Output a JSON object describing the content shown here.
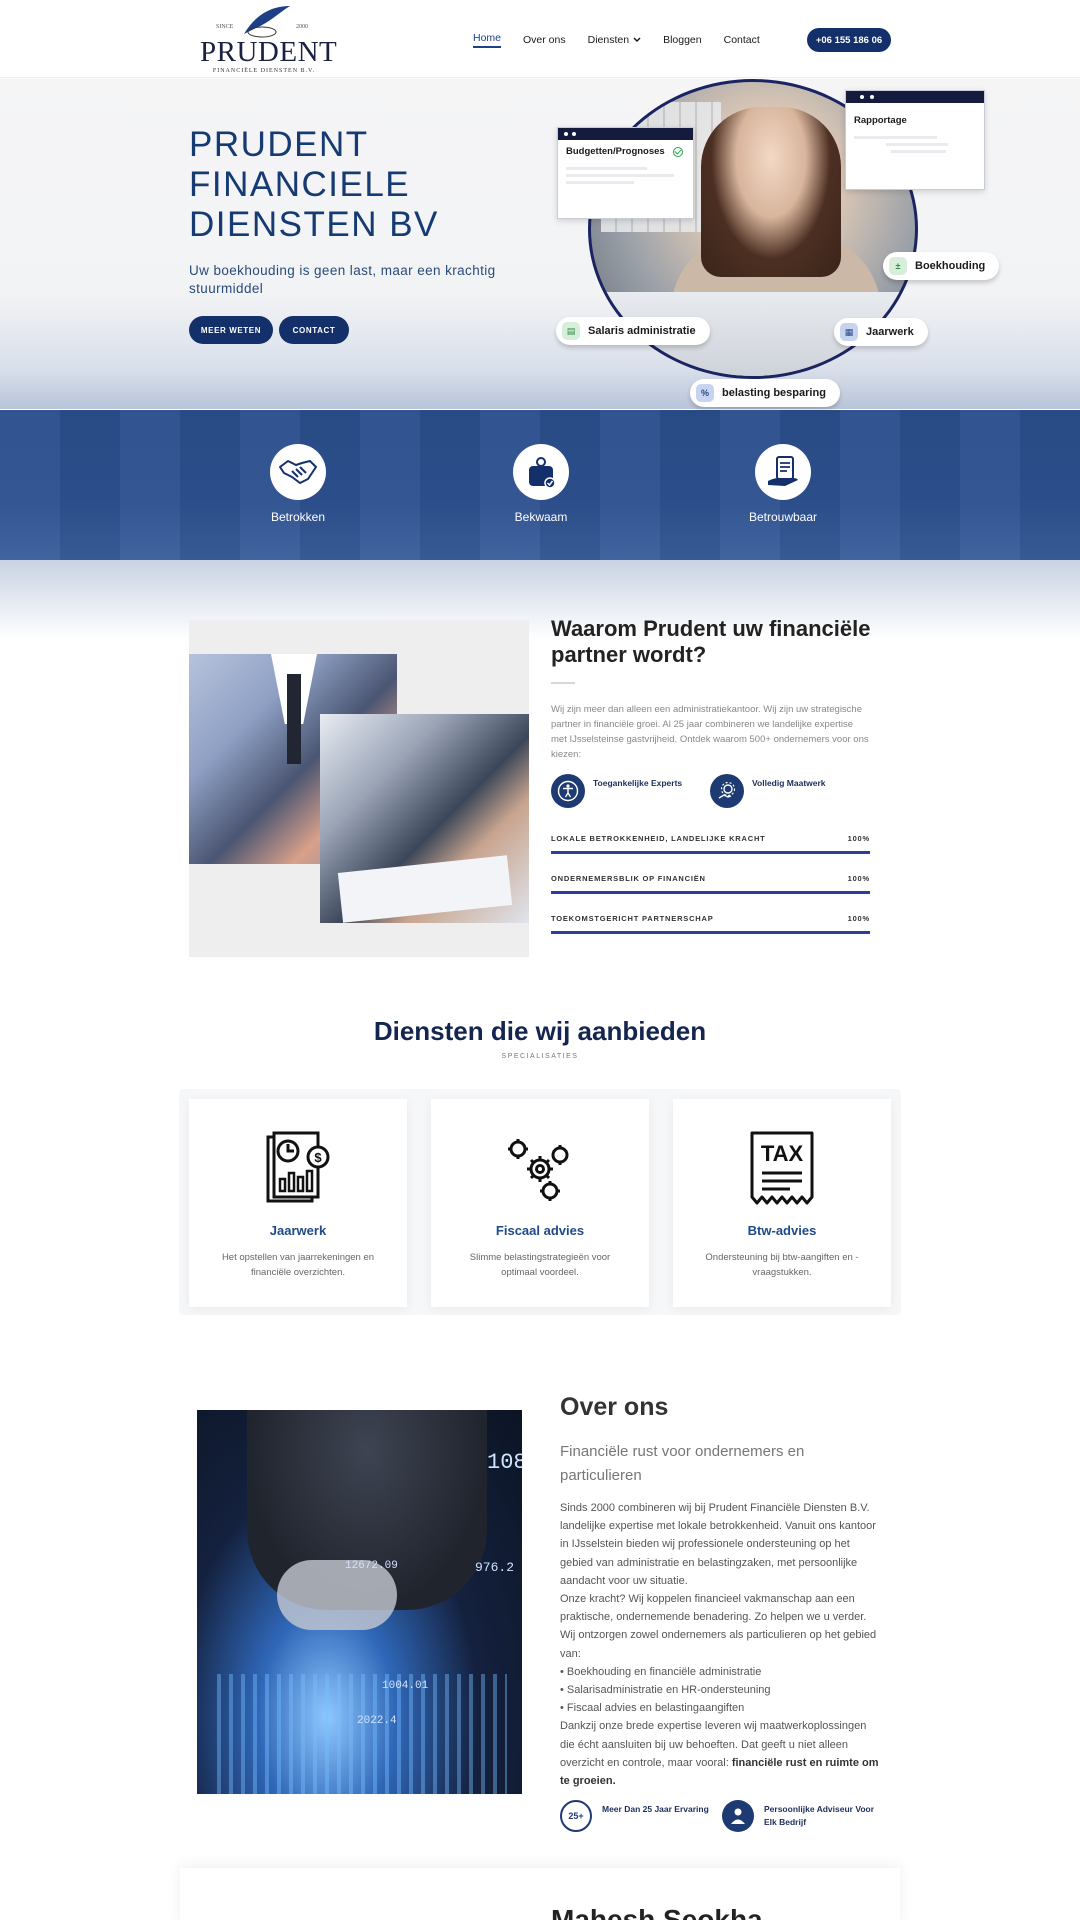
{
  "header": {
    "logo": {
      "since": "SINCE",
      "year": "2000",
      "word": "PRUDENT",
      "sub": "FINANCIËLE DIENSTEN B.V."
    },
    "nav": [
      {
        "label": "Home",
        "active": true
      },
      {
        "label": "Over ons"
      },
      {
        "label": "Diensten",
        "dropdown": true
      },
      {
        "label": "Bloggen"
      },
      {
        "label": "Contact"
      }
    ],
    "phone": "+06 155 186 06"
  },
  "hero": {
    "title_lines": [
      "PRUDENT",
      "FINANCIELE",
      "DIENSTEN BV"
    ],
    "subtitle": "Uw boekhouding is geen last, maar een krachtig stuurmiddel",
    "btn_more": "MEER WETEN",
    "btn_contact": "CONTACT",
    "card_budget": "Budgetten/Prognoses",
    "card_report": "Rapportage",
    "chip_salaris": "Salaris administratie",
    "chip_boek": "Boekhouding",
    "chip_jaar": "Jaarwerk",
    "chip_belast": "belasting besparing"
  },
  "values": [
    {
      "label": "Betrokken",
      "icon": "handshake-icon"
    },
    {
      "label": "Bekwaam",
      "icon": "skill-icon"
    },
    {
      "label": "Betrouwbaar",
      "icon": "trust-icon"
    }
  ],
  "why": {
    "title": "Waarom Prudent uw financiële partner wordt?",
    "text": "Wij zijn meer dan alleen een administratiekantoor. Wij zijn uw strategische partner in financiële groei. Al 25 jaar combineren we landelijke expertise met IJsselsteinse gastvrijheid. Ontdek waarom 500+ ondernemers voor ons kiezen:",
    "features": [
      "Toegankelijke Experts",
      "Volledig Maatwerk"
    ],
    "bars": [
      {
        "label": "LOKALE BETROKKENHEID, LANDELIJKE KRACHT",
        "value": "100%"
      },
      {
        "label": "ONDERNEMERSBLIK OP FINANCIËN",
        "value": "100%"
      },
      {
        "label": "TOEKOMSTGERICHT PARTNERSCHAP",
        "value": "100%"
      }
    ]
  },
  "services": {
    "title": "Diensten die wij aanbieden",
    "subtitle": "SPECIALISATIES",
    "cards": [
      {
        "name": "Jaarwerk",
        "desc": "Het opstellen van jaarrekeningen en financiële overzichten."
      },
      {
        "name": "Fiscaal advies",
        "desc": "Slimme belastingstrategieën voor optimaal voordeel."
      },
      {
        "name": "Btw-advies",
        "desc": "Ondersteuning bij btw-aangiften en -vraagstukken."
      }
    ]
  },
  "about": {
    "title": "Over ons",
    "subtitle": "Financiële rust voor ondernemers en particulieren",
    "p1": "Sinds 2000 combineren wij bij Prudent Financiële Diensten B.V. landelijke expertise met lokale betrokkenheid. Vanuit ons kantoor in IJsselstein bieden wij professionele ondersteuning op het gebied van administratie en belastingzaken, met persoonlijke aandacht voor uw situatie.",
    "p2": "Onze kracht? Wij koppelen financieel vakmanschap aan een praktische, ondernemende benadering. Zo helpen we u verder. Wij ontzorgen zowel ondernemers als particulieren op het gebied van:",
    "bullets": [
      "• Boekhouding en financiële administratie",
      "• Salarisadministratie en HR-ondersteuning",
      "• Fiscaal advies en belastingaangiften"
    ],
    "p3": "Dankzij onze brede expertise leveren wij maatwerkoplossingen die écht aansluiten bij uw behoeften. Dat geeft u niet alleen overzicht en controle, maar vooral: ",
    "p3_bold": "financiële rust en ruimte om te groeien.",
    "feat1": "Meer Dan 25 Jaar Ervaring",
    "feat1_badge": "25+",
    "feat2": "Persoonlijke Adviseur Voor Elk Bedrijf",
    "img_numbers": [
      "108",
      "12672.09",
      "976.2",
      "1004.01",
      "2022.4"
    ]
  },
  "teaser": {
    "title": "Mahesh Seokha"
  }
}
